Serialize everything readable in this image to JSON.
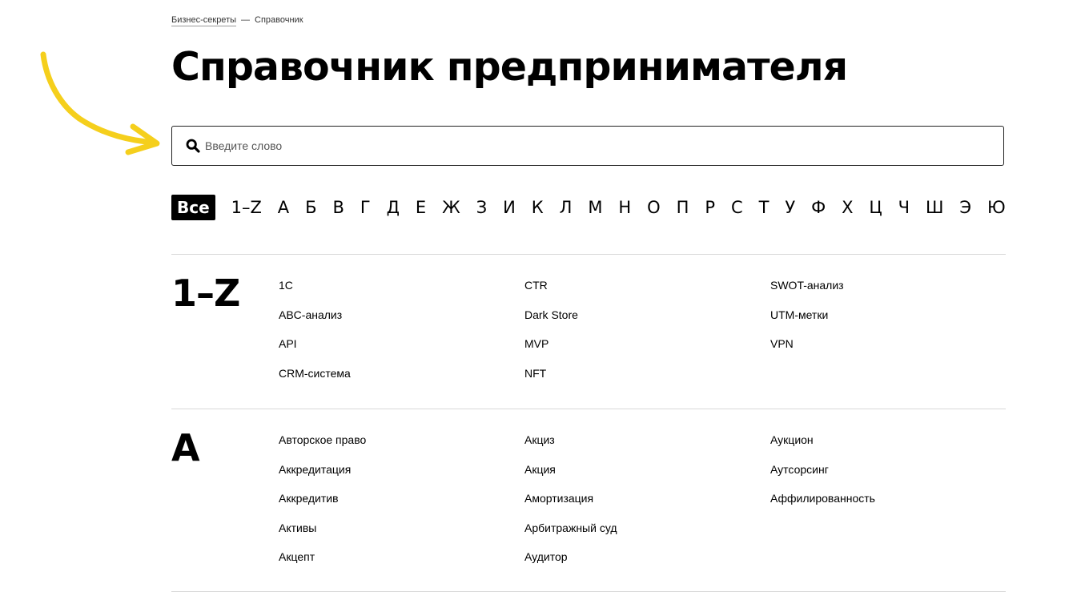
{
  "breadcrumb": {
    "parent": "Бизнес-секреты",
    "separator": "—",
    "current": "Справочник"
  },
  "page_title": "Справочник предпринимателя",
  "search": {
    "placeholder": "Введите слово",
    "value": ""
  },
  "alphabet": [
    "Все",
    "1–Z",
    "А",
    "Б",
    "В",
    "Г",
    "Д",
    "Е",
    "Ж",
    "З",
    "И",
    "К",
    "Л",
    "М",
    "Н",
    "О",
    "П",
    "Р",
    "С",
    "Т",
    "У",
    "Ф",
    "Х",
    "Ц",
    "Ч",
    "Ш",
    "Э",
    "Ю"
  ],
  "alphabet_active": "Все",
  "sections": [
    {
      "letter": "1–Z",
      "columns": [
        [
          "1С",
          "ABC-анализ",
          "API",
          "CRM-система"
        ],
        [
          "CTR",
          "Dark Store",
          "MVP",
          "NFT"
        ],
        [
          "SWOT-анализ",
          "UTM-метки",
          "VPN"
        ]
      ]
    },
    {
      "letter": "А",
      "columns": [
        [
          "Авторское право",
          "Аккредитация",
          "Аккредитив",
          "Активы",
          "Акцепт"
        ],
        [
          "Акциз",
          "Акция",
          "Амортизация",
          "Арбитражный суд",
          "Аудитор"
        ],
        [
          "Аукцион",
          "Аутсорсинг",
          "Аффилированность"
        ]
      ]
    }
  ],
  "colors": {
    "arrow": "#f5cf1c",
    "divider": "#d9d9d9",
    "text": "#000000"
  },
  "icons": {
    "search": "search-icon",
    "annotation": "yellow-arrow"
  }
}
